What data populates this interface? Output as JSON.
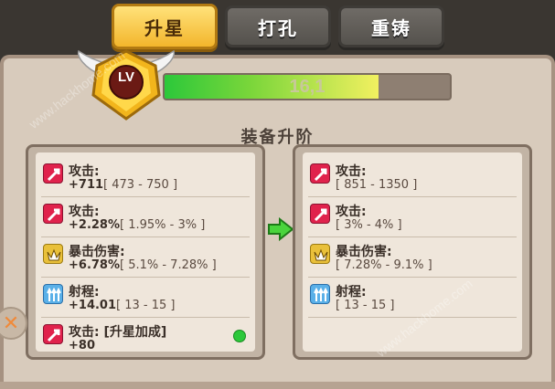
{
  "tabs": {
    "star_up": "升星",
    "punch": "打孔",
    "recast": "重铸"
  },
  "level": {
    "badge_text": "LV",
    "progress_text": "16,1",
    "progress_fraction": 0.75
  },
  "section_title": "装备升阶",
  "left_stats": [
    {
      "icon": "attack-icon",
      "label": "攻击:",
      "value": "+711",
      "range": "[ 473 - 750 ]"
    },
    {
      "icon": "attack-icon",
      "label": "攻击:",
      "value": "+2.28%",
      "range": "[ 1.95% - 3% ]"
    },
    {
      "icon": "crit-damage-icon",
      "label": "暴击伤害:",
      "value": "+6.78%",
      "range": "[ 5.1% - 7.28% ]"
    },
    {
      "icon": "range-icon",
      "label": "射程:",
      "value": "+14.01",
      "range": "[ 13 - 15 ]"
    },
    {
      "icon": "attack-icon",
      "label": "攻击:  [升星加成]",
      "value": "+80",
      "range": ""
    }
  ],
  "right_stats": [
    {
      "icon": "attack-icon",
      "label": "攻击:",
      "range": "[ 851 - 1350 ]"
    },
    {
      "icon": "attack-icon",
      "label": "攻击:",
      "range": "[ 3% - 4% ]"
    },
    {
      "icon": "crit-damage-icon",
      "label": "暴击伤害:",
      "range": "[ 7.28% - 9.1% ]"
    },
    {
      "icon": "range-icon",
      "label": "射程:",
      "range": "[ 13 - 15 ]"
    }
  ],
  "watermark": "www.hackhome.com"
}
